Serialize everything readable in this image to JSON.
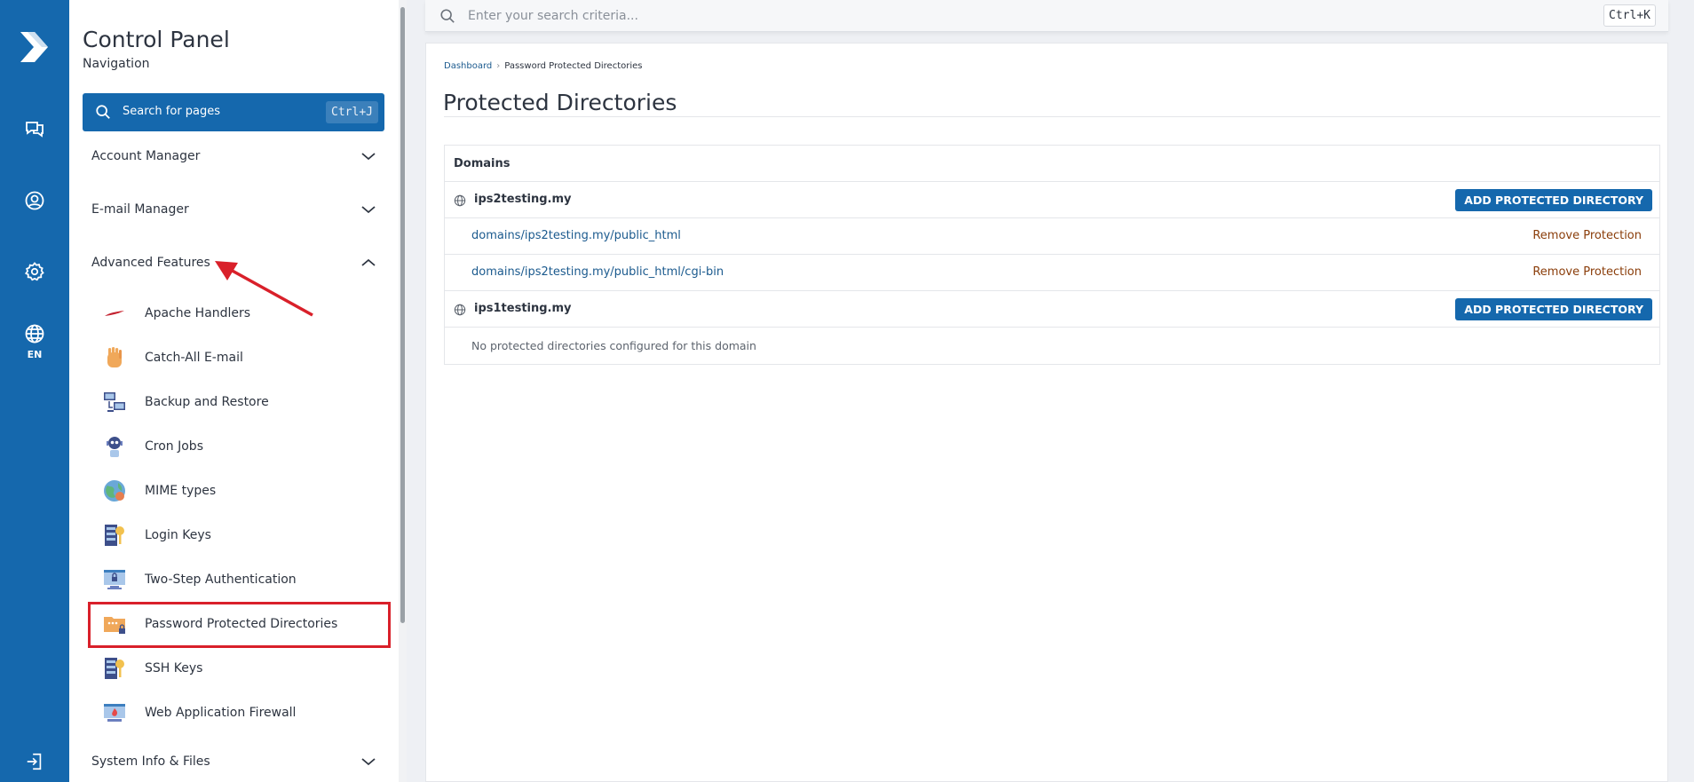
{
  "rail": {
    "lang": "EN",
    "icons": [
      "logo-icon",
      "chat-icon",
      "user-icon",
      "gear-icon",
      "globe-icon",
      "logout-icon"
    ]
  },
  "sidebar": {
    "title": "Control Panel",
    "subtitle": "Navigation",
    "search_label": "Search for pages",
    "search_shortcut": "Ctrl+J",
    "sections": [
      {
        "label": "Account Manager",
        "expanded": false
      },
      {
        "label": "E-mail Manager",
        "expanded": false
      },
      {
        "label": "Advanced Features",
        "expanded": true
      },
      {
        "label": "System Info & Files",
        "expanded": false
      }
    ],
    "items": [
      {
        "label": "Apache Handlers",
        "icon": "apache-feather-icon"
      },
      {
        "label": "Catch-All E-mail",
        "icon": "hand-icon"
      },
      {
        "label": "Backup and Restore",
        "icon": "backup-computers-icon"
      },
      {
        "label": "Cron Jobs",
        "icon": "robot-icon"
      },
      {
        "label": "MIME types",
        "icon": "mime-globe-icon"
      },
      {
        "label": "Login Keys",
        "icon": "server-key-icon"
      },
      {
        "label": "Two-Step Authentication",
        "icon": "monitor-lock-icon"
      },
      {
        "label": "Password Protected Directories",
        "icon": "folder-lock-icon"
      },
      {
        "label": "SSH Keys",
        "icon": "ssh-key-icon"
      },
      {
        "label": "Web Application Firewall",
        "icon": "firewall-icon"
      }
    ],
    "active_item": "Password Protected Directories"
  },
  "topbar": {
    "search_placeholder": "Enter your search criteria...",
    "search_shortcut": "Ctrl+K"
  },
  "main": {
    "breadcrumb": {
      "root": "Dashboard",
      "current": "Password Protected Directories"
    },
    "title": "Protected Directories",
    "table_header": "Domains",
    "domains": [
      {
        "name": "ips2testing.my",
        "button": "ADD PROTECTED DIRECTORY",
        "directories": [
          {
            "path": "domains/ips2testing.my/public_html",
            "action": "Remove Protection"
          },
          {
            "path": "domains/ips2testing.my/public_html/cgi-bin",
            "action": "Remove Protection"
          }
        ]
      },
      {
        "name": "ips1testing.my",
        "button": "ADD PROTECTED DIRECTORY",
        "empty_text": "No protected directories configured for this domain"
      }
    ]
  },
  "colors": {
    "brand": "#1568ad",
    "link": "#1b5a8e",
    "remove": "#8a3d0a",
    "highlight": "#d9202a"
  }
}
